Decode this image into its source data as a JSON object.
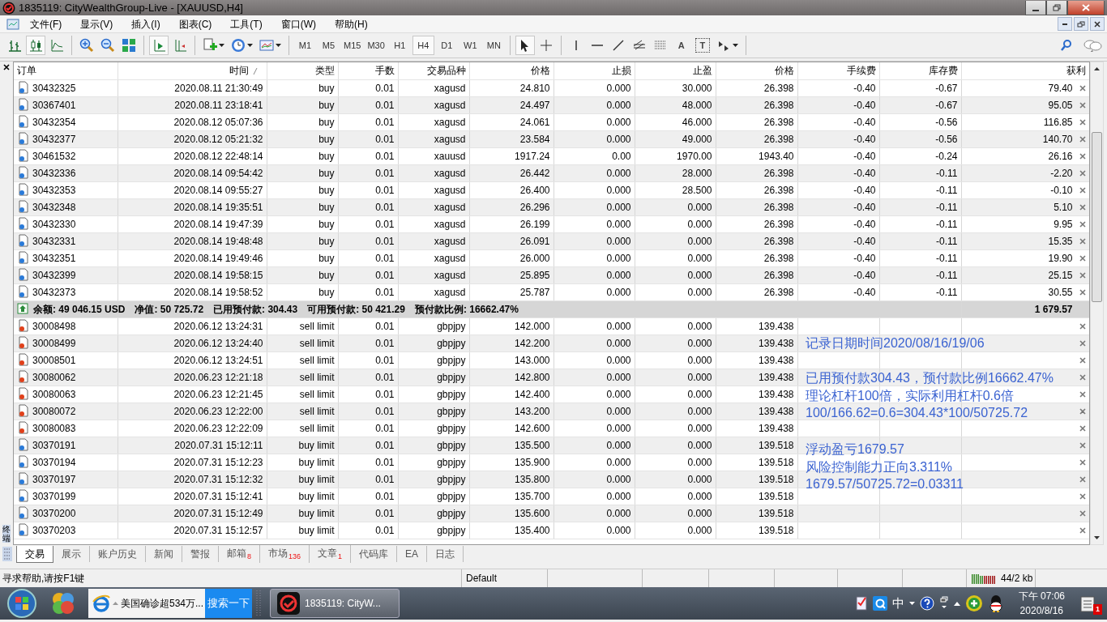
{
  "window": {
    "title": "1835119: CityWealthGroup-Live - [XAUUSD,H4]"
  },
  "menu": [
    "文件(F)",
    "显示(V)",
    "插入(I)",
    "图表(C)",
    "工具(T)",
    "窗口(W)",
    "帮助(H)"
  ],
  "toolbar": {
    "timeframes": [
      {
        "label": "M1",
        "selected": false
      },
      {
        "label": "M5",
        "selected": false
      },
      {
        "label": "M15",
        "selected": false
      },
      {
        "label": "M30",
        "selected": false
      },
      {
        "label": "H1",
        "selected": false
      },
      {
        "label": "H4",
        "selected": true
      },
      {
        "label": "D1",
        "selected": false
      },
      {
        "label": "W1",
        "selected": false
      },
      {
        "label": "MN",
        "selected": false
      }
    ],
    "text_tool": "A",
    "label_tool": "T"
  },
  "panel_label": "终端",
  "table": {
    "columns": [
      "订单",
      "时间",
      "类型",
      "手数",
      "交易品种",
      "价格",
      "止损",
      "止盈",
      "价格",
      "手续费",
      "库存费",
      "获利"
    ],
    "open_rows": [
      {
        "kind": "buy",
        "cells": [
          "30432325",
          "2020.08.11 21:30:49",
          "buy",
          "0.01",
          "xagusd",
          "24.810",
          "0.000",
          "30.000",
          "26.398",
          "-0.40",
          "-0.67",
          "79.40"
        ]
      },
      {
        "kind": "buy",
        "cells": [
          "30367401",
          "2020.08.11 23:18:41",
          "buy",
          "0.01",
          "xagusd",
          "24.497",
          "0.000",
          "48.000",
          "26.398",
          "-0.40",
          "-0.67",
          "95.05"
        ]
      },
      {
        "kind": "buy",
        "cells": [
          "30432354",
          "2020.08.12 05:07:36",
          "buy",
          "0.01",
          "xagusd",
          "24.061",
          "0.000",
          "46.000",
          "26.398",
          "-0.40",
          "-0.56",
          "116.85"
        ]
      },
      {
        "kind": "buy",
        "cells": [
          "30432377",
          "2020.08.12 05:21:32",
          "buy",
          "0.01",
          "xagusd",
          "23.584",
          "0.000",
          "49.000",
          "26.398",
          "-0.40",
          "-0.56",
          "140.70"
        ]
      },
      {
        "kind": "buy",
        "cells": [
          "30461532",
          "2020.08.12 22:48:14",
          "buy",
          "0.01",
          "xauusd",
          "1917.24",
          "0.00",
          "1970.00",
          "1943.40",
          "-0.40",
          "-0.24",
          "26.16"
        ]
      },
      {
        "kind": "buy",
        "cells": [
          "30432336",
          "2020.08.14 09:54:42",
          "buy",
          "0.01",
          "xagusd",
          "26.442",
          "0.000",
          "28.000",
          "26.398",
          "-0.40",
          "-0.11",
          "-2.20"
        ]
      },
      {
        "kind": "buy",
        "cells": [
          "30432353",
          "2020.08.14 09:55:27",
          "buy",
          "0.01",
          "xagusd",
          "26.400",
          "0.000",
          "28.500",
          "26.398",
          "-0.40",
          "-0.11",
          "-0.10"
        ]
      },
      {
        "kind": "buy",
        "cells": [
          "30432348",
          "2020.08.14 19:35:51",
          "buy",
          "0.01",
          "xagusd",
          "26.296",
          "0.000",
          "0.000",
          "26.398",
          "-0.40",
          "-0.11",
          "5.10"
        ]
      },
      {
        "kind": "buy",
        "cells": [
          "30432330",
          "2020.08.14 19:47:39",
          "buy",
          "0.01",
          "xagusd",
          "26.199",
          "0.000",
          "0.000",
          "26.398",
          "-0.40",
          "-0.11",
          "9.95"
        ]
      },
      {
        "kind": "buy",
        "cells": [
          "30432331",
          "2020.08.14 19:48:48",
          "buy",
          "0.01",
          "xagusd",
          "26.091",
          "0.000",
          "0.000",
          "26.398",
          "-0.40",
          "-0.11",
          "15.35"
        ]
      },
      {
        "kind": "buy",
        "cells": [
          "30432351",
          "2020.08.14 19:49:46",
          "buy",
          "0.01",
          "xagusd",
          "26.000",
          "0.000",
          "0.000",
          "26.398",
          "-0.40",
          "-0.11",
          "19.90"
        ]
      },
      {
        "kind": "buy",
        "cells": [
          "30432399",
          "2020.08.14 19:58:15",
          "buy",
          "0.01",
          "xagusd",
          "25.895",
          "0.000",
          "0.000",
          "26.398",
          "-0.40",
          "-0.11",
          "25.15"
        ]
      },
      {
        "kind": "buy",
        "cells": [
          "30432373",
          "2020.08.14 19:58:52",
          "buy",
          "0.01",
          "xagusd",
          "25.787",
          "0.000",
          "0.000",
          "26.398",
          "-0.40",
          "-0.11",
          "30.55"
        ]
      }
    ],
    "summary": {
      "items": [
        "余额: 49 046.15 USD",
        "净值: 50 725.72",
        "已用预付款: 304.43",
        "可用预付款: 50 421.29",
        "预付款比例: 16662.47%"
      ],
      "profit": "1 679.57"
    },
    "pending_rows": [
      {
        "kind": "sell",
        "cells": [
          "30008498",
          "2020.06.12 13:24:31",
          "sell limit",
          "0.01",
          "gbpjpy",
          "142.000",
          "0.000",
          "0.000",
          "139.438"
        ]
      },
      {
        "kind": "sell",
        "cells": [
          "30008499",
          "2020.06.12 13:24:40",
          "sell limit",
          "0.01",
          "gbpjpy",
          "142.200",
          "0.000",
          "0.000",
          "139.438"
        ]
      },
      {
        "kind": "sell",
        "cells": [
          "30008501",
          "2020.06.12 13:24:51",
          "sell limit",
          "0.01",
          "gbpjpy",
          "143.000",
          "0.000",
          "0.000",
          "139.438"
        ]
      },
      {
        "kind": "sell",
        "cells": [
          "30080062",
          "2020.06.23 12:21:18",
          "sell limit",
          "0.01",
          "gbpjpy",
          "142.800",
          "0.000",
          "0.000",
          "139.438"
        ]
      },
      {
        "kind": "sell",
        "cells": [
          "30080063",
          "2020.06.23 12:21:45",
          "sell limit",
          "0.01",
          "gbpjpy",
          "142.400",
          "0.000",
          "0.000",
          "139.438"
        ]
      },
      {
        "kind": "sell",
        "cells": [
          "30080072",
          "2020.06.23 12:22:00",
          "sell limit",
          "0.01",
          "gbpjpy",
          "143.200",
          "0.000",
          "0.000",
          "139.438"
        ]
      },
      {
        "kind": "sell",
        "cells": [
          "30080083",
          "2020.06.23 12:22:09",
          "sell limit",
          "0.01",
          "gbpjpy",
          "142.600",
          "0.000",
          "0.000",
          "139.438"
        ]
      },
      {
        "kind": "buy",
        "cells": [
          "30370191",
          "2020.07.31 15:12:11",
          "buy limit",
          "0.01",
          "gbpjpy",
          "135.500",
          "0.000",
          "0.000",
          "139.518"
        ]
      },
      {
        "kind": "buy",
        "cells": [
          "30370194",
          "2020.07.31 15:12:23",
          "buy limit",
          "0.01",
          "gbpjpy",
          "135.900",
          "0.000",
          "0.000",
          "139.518"
        ]
      },
      {
        "kind": "buy",
        "cells": [
          "30370197",
          "2020.07.31 15:12:32",
          "buy limit",
          "0.01",
          "gbpjpy",
          "135.800",
          "0.000",
          "0.000",
          "139.518"
        ]
      },
      {
        "kind": "buy",
        "cells": [
          "30370199",
          "2020.07.31 15:12:41",
          "buy limit",
          "0.01",
          "gbpjpy",
          "135.700",
          "0.000",
          "0.000",
          "139.518"
        ]
      },
      {
        "kind": "buy",
        "cells": [
          "30370200",
          "2020.07.31 15:12:49",
          "buy limit",
          "0.01",
          "gbpjpy",
          "135.600",
          "0.000",
          "0.000",
          "139.518"
        ]
      },
      {
        "kind": "buy",
        "cells": [
          "30370203",
          "2020.07.31 15:12:57",
          "buy limit",
          "0.01",
          "gbpjpy",
          "135.400",
          "0.000",
          "0.000",
          "139.518"
        ]
      }
    ]
  },
  "annotations": [
    [
      "记录日期时间2020/08/16/19/06"
    ],
    [
      "已用预付款304.43，预付款比例16662.47%",
      "理论杠杆100倍，实际利用杠杆0.6倍",
      "100/166.62=0.6=304.43*100/50725.72"
    ],
    [
      "浮动盈亏1679.57",
      "风险控制能力正向3.311%",
      "1679.57/50725.72=0.03311"
    ]
  ],
  "tabs": [
    {
      "label": "交易",
      "selected": true
    },
    {
      "label": "展示",
      "selected": false
    },
    {
      "label": "账户历史",
      "selected": false
    },
    {
      "label": "新闻",
      "selected": false
    },
    {
      "label": "警报",
      "selected": false
    },
    {
      "label": "邮箱",
      "count": "8",
      "selected": false
    },
    {
      "label": "市场",
      "count": "136",
      "selected": false
    },
    {
      "label": "文章",
      "count": "1",
      "selected": false
    },
    {
      "label": "代码库",
      "selected": false
    },
    {
      "label": "EA",
      "selected": false
    },
    {
      "label": "日志",
      "selected": false
    }
  ],
  "status_bar": {
    "help": "寻求帮助,请按F1键",
    "profile": "Default",
    "traffic": "44/2 kb"
  },
  "taskbar": {
    "browser_item": "美国确诊超534万...",
    "search_button": "搜索一下",
    "app_item": "1835119: CityW...",
    "input_method": "中",
    "time": "下午 07:06",
    "date": "2020/8/16",
    "notification_count": "1"
  }
}
